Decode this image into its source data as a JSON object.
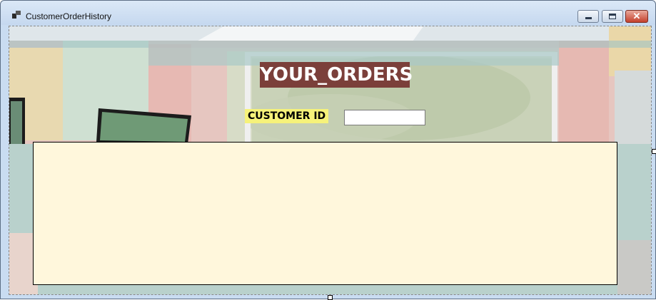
{
  "window": {
    "title": "CustomerOrderHistory",
    "icons": [
      "app-icon",
      "minimize-icon",
      "maximize-icon",
      "close-icon"
    ]
  },
  "form": {
    "heading": "YOUR_ORDERS",
    "customer_id_label": "CUSTOMER ID",
    "customer_id_value": "",
    "colors": {
      "heading_bg": "#7b3f3a",
      "label_bg": "#f6f27a",
      "grid_bg": "#fff7dc"
    }
  }
}
